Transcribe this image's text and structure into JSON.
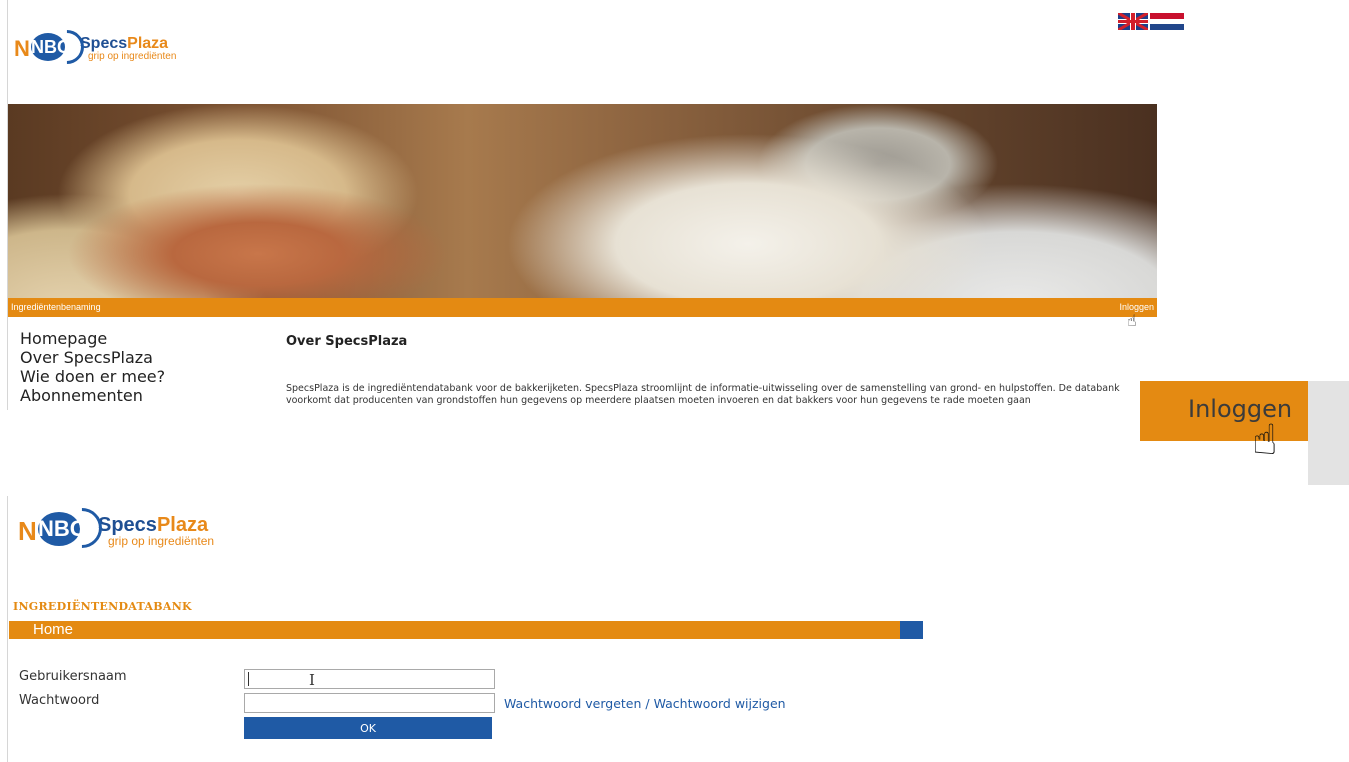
{
  "header": {
    "logo_letters": "NBC",
    "logo_specs": "Specs",
    "logo_plaza": "Plaza",
    "logo_tagline": "grip op ingrediënten"
  },
  "flags": [
    "english-flag-icon",
    "dutch-flag-icon"
  ],
  "colors": {
    "orange": "#e48a12",
    "blue": "#1f5aa5",
    "text": "#333333"
  },
  "top_page": {
    "bar_left_label": "Ingrediëntenbenaming",
    "bar_right_label": "Inloggen",
    "nav": [
      {
        "label": "Homepage"
      },
      {
        "label": "Over SpecsPlaza"
      },
      {
        "label": "Wie doen er mee?"
      },
      {
        "label": "Abonnementen"
      }
    ],
    "active_nav": "Over SpecsPlaza",
    "content_title": "Over SpecsPlaza",
    "content_text": "SpecsPlaza is de ingrediëntendatabank voor de bakkerijketen. SpecsPlaza stroomlijnt de informatie-uitwisseling over de samenstelling van grond- en hulpstoffen. De databank voorkomt dat producenten van grondstoffen hun gegevens op meerdere plaatsen moeten invoeren en dat bakkers voor hun gegevens te rade moeten gaan"
  },
  "zoom": {
    "label": "Inloggen"
  },
  "login_page": {
    "section_title": "INGREDIËNTENDATABANK",
    "bar_label": "Home",
    "username_label": "Gebruikersnaam",
    "password_label": "Wachtwoord",
    "username_value": "",
    "password_value": "",
    "forgot_link": "Wachtwoord vergeten / Wachtwoord wijzigen",
    "ok_label": "OK"
  }
}
